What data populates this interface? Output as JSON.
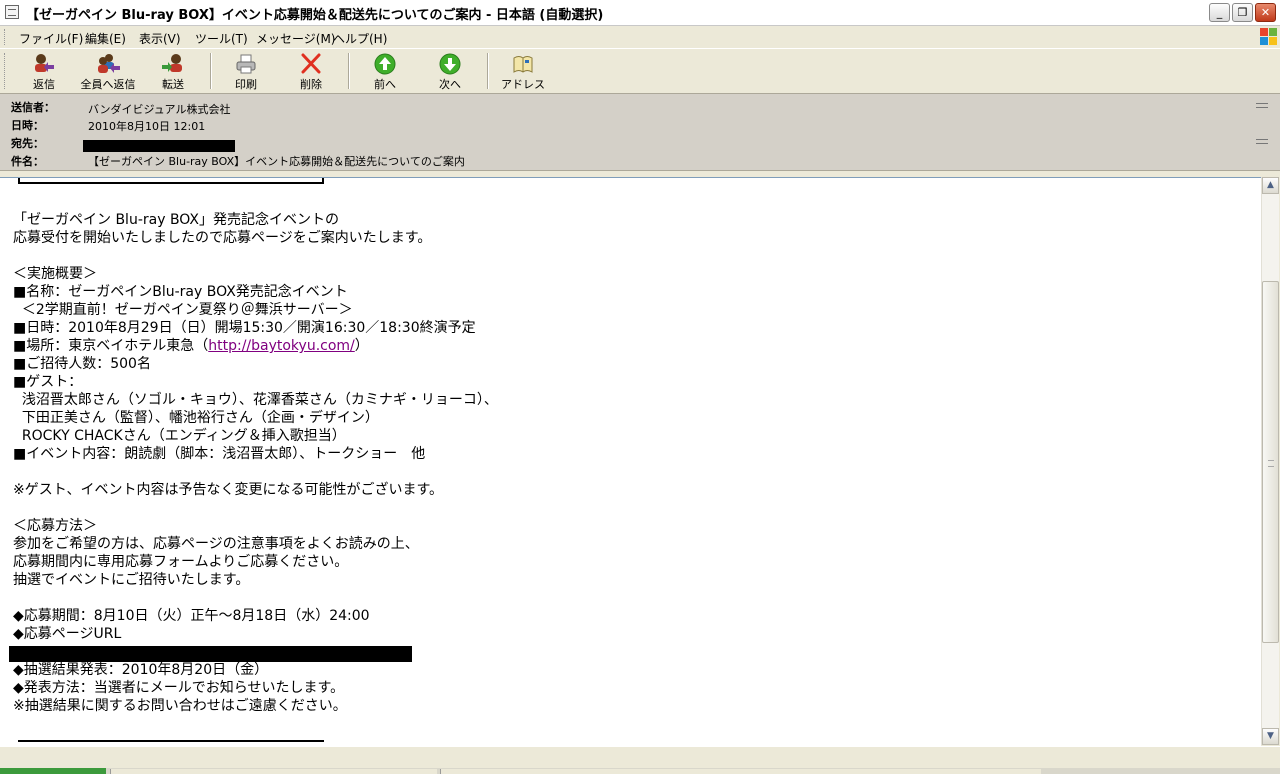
{
  "window": {
    "title": "【ゼーガペイン Blu-ray BOX】イベント応募開始＆配送先についてのご案内 - 日本語 (自動選択)",
    "minimize": "_",
    "restore": "❐",
    "close": "✕"
  },
  "menu": [
    "ファイル(F)",
    "編集(E)",
    "表示(V)",
    "ツール(T)",
    "メッセージ(M)",
    "ヘルプ(H)"
  ],
  "toolbar": {
    "reply": "返信",
    "reply_all": "全員へ返信",
    "forward": "転送",
    "print": "印刷",
    "delete": "削除",
    "previous": "前へ",
    "next": "次へ",
    "addresses": "アドレス"
  },
  "header": {
    "from_label": "送信者：",
    "from_value": "バンダイビジュアル株式会社",
    "date_label": "日時：",
    "date_value": "2010年8月10日 12:01",
    "to_label": "宛先：",
    "subject_label": "件名：",
    "subject_value": "【ゼーガペイン Blu-ray BOX】イベント応募開始＆配送先についてのご案内"
  },
  "body": {
    "l1": "「ゼーガペイン Blu-ray BOX」発売記念イベントの",
    "l2": "応募受付を開始いたしましたので応募ページをご案内いたします。",
    "l3": "＜実施概要＞",
    "l4": "■名称：ゼーガペインBlu-ray BOX発売記念イベント",
    "l5": "  ＜2学期直前！ゼーガペイン夏祭り＠舞浜サーバー＞",
    "l6": "■日時：2010年8月29日（日）開場15:30／開演16:30／18:30終演予定",
    "l7_pre": "■場所：東京ベイホテル東急（",
    "l7_link": "http://baytokyu.com/",
    "l7_post": "）",
    "l8": "■ご招待人数：500名",
    "l9": "■ゲスト：",
    "l10": "  浅沼晋太郎さん（ソゴル・キョウ）、花澤香菜さん（カミナギ・リョーコ）、",
    "l11": "  下田正美さん（監督）、幡池裕行さん（企画・デザイン）",
    "l12": "  ROCKY CHACKさん（エンディング＆挿入歌担当）",
    "l13": "■イベント内容：朗読劇（脚本：浅沼晋太郎）、トークショー　他",
    "l14": "※ゲスト、イベント内容は予告なく変更になる可能性がございます。",
    "l15": "＜応募方法＞",
    "l16": "参加をご希望の方は、応募ページの注意事項をよくお読みの上、",
    "l17": "応募期間内に専用応募フォームよりご応募ください。",
    "l18": "抽選でイベントにご招待いたします。",
    "l19": "◆応募期間：8月10日（火）正午～8月18日（水）24:00",
    "l20": "◆応募ページURL",
    "l21": "◆抽選結果発表：2010年8月20日（金）",
    "l22": "◆発表方法：当選者にメールでお知らせいたします。",
    "l23": "※抽選結果に関するお問い合わせはご遠慮ください。"
  },
  "colors": {
    "chrome": "#ece9d8",
    "header_bg": "#d4d0c8",
    "link_visited": "#800080",
    "delete_red": "#e03020",
    "nav_green": "#3fae2a"
  }
}
